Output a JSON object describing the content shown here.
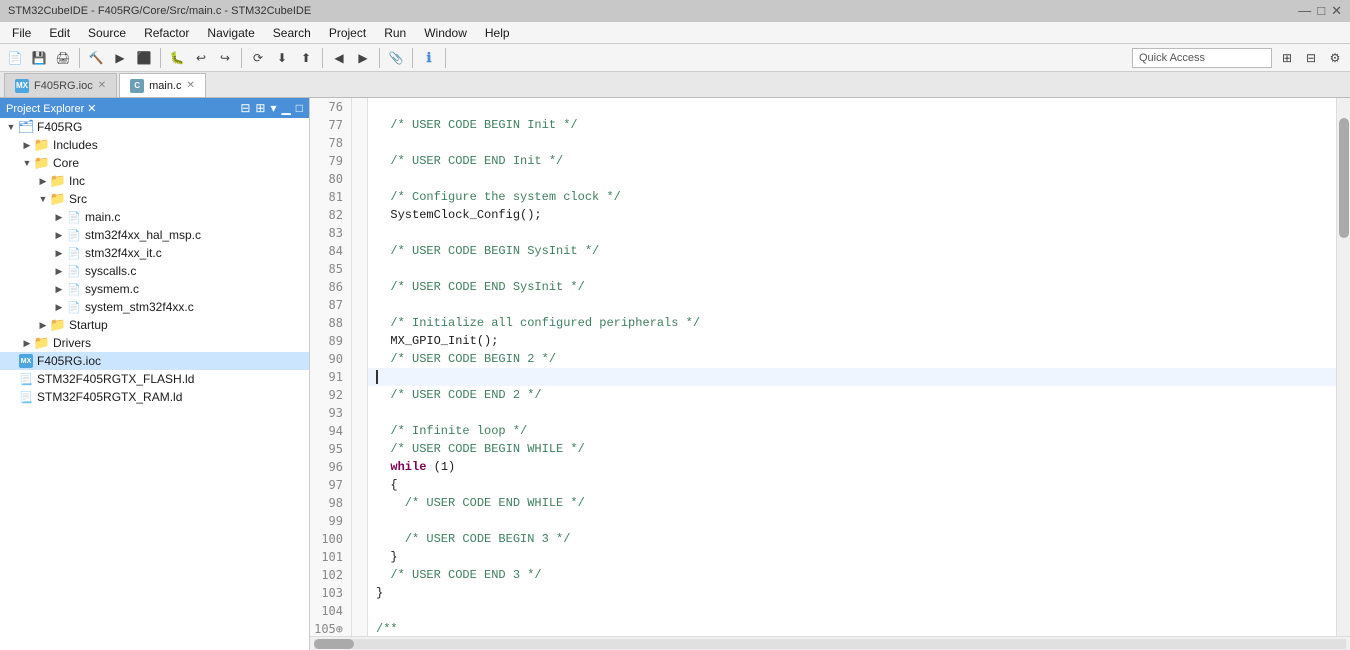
{
  "titlebar": {
    "title": "STM32CubeIDE - F405RG/Core/Src/main.c - STM32CubeIDE",
    "controls": [
      "—",
      "□",
      "✕"
    ]
  },
  "menubar": {
    "items": [
      "File",
      "Edit",
      "Source",
      "Refactor",
      "Navigate",
      "Search",
      "Project",
      "Run",
      "Window",
      "Help"
    ]
  },
  "toolbar": {
    "quick_access": "Quick Access"
  },
  "tabs": [
    {
      "label": "F405RG.ioc",
      "type": "ioc",
      "active": false
    },
    {
      "label": "main.c",
      "type": "c",
      "active": true
    }
  ],
  "sidebar": {
    "title": "Project Explorer",
    "tree": [
      {
        "level": 0,
        "arrow": "▼",
        "icon": "project",
        "label": "F405RG",
        "type": "project"
      },
      {
        "level": 1,
        "arrow": "▶",
        "icon": "folder",
        "label": "Includes",
        "type": "folder"
      },
      {
        "level": 1,
        "arrow": "▼",
        "icon": "folder",
        "label": "Core",
        "type": "folder"
      },
      {
        "level": 2,
        "arrow": "▶",
        "icon": "folder",
        "label": "Inc",
        "type": "folder"
      },
      {
        "level": 2,
        "arrow": "▼",
        "icon": "folder",
        "label": "Src",
        "type": "folder"
      },
      {
        "level": 3,
        "arrow": "▶",
        "icon": "file-c",
        "label": "main.c",
        "type": "file"
      },
      {
        "level": 3,
        "arrow": "▶",
        "icon": "file-c",
        "label": "stm32f4xx_hal_msp.c",
        "type": "file"
      },
      {
        "level": 3,
        "arrow": "▶",
        "icon": "file-c",
        "label": "stm32f4xx_it.c",
        "type": "file"
      },
      {
        "level": 3,
        "arrow": "▶",
        "icon": "file-c",
        "label": "syscalls.c",
        "type": "file"
      },
      {
        "level": 3,
        "arrow": "▶",
        "icon": "file-c",
        "label": "sysmem.c",
        "type": "file"
      },
      {
        "level": 3,
        "arrow": "▶",
        "icon": "file-c",
        "label": "system_stm32f4xx.c",
        "type": "file"
      },
      {
        "level": 2,
        "arrow": "▶",
        "icon": "folder",
        "label": "Startup",
        "type": "folder"
      },
      {
        "level": 1,
        "arrow": "▶",
        "icon": "folder",
        "label": "Drivers",
        "type": "folder"
      },
      {
        "level": 0,
        "arrow": "",
        "icon": "ioc",
        "label": "F405RG.ioc",
        "type": "ioc",
        "selected": true
      },
      {
        "level": 0,
        "arrow": "",
        "icon": "ld",
        "label": "STM32F405RGTX_FLASH.ld",
        "type": "ld"
      },
      {
        "level": 0,
        "arrow": "",
        "icon": "ld",
        "label": "STM32F405RGTX_RAM.ld",
        "type": "ld"
      }
    ]
  },
  "code": {
    "lines": [
      {
        "num": 76,
        "text": "",
        "type": "normal"
      },
      {
        "num": 77,
        "text": "  /* USER CODE BEGIN Init */",
        "type": "comment"
      },
      {
        "num": 78,
        "text": "",
        "type": "normal"
      },
      {
        "num": 79,
        "text": "  /* USER CODE END Init */",
        "type": "comment"
      },
      {
        "num": 80,
        "text": "",
        "type": "normal"
      },
      {
        "num": 81,
        "text": "  /* Configure the system clock */",
        "type": "comment"
      },
      {
        "num": 82,
        "text": "  SystemClock_Config();",
        "type": "normal"
      },
      {
        "num": 83,
        "text": "",
        "type": "normal"
      },
      {
        "num": 84,
        "text": "  /* USER CODE BEGIN SysInit */",
        "type": "comment"
      },
      {
        "num": 85,
        "text": "",
        "type": "normal"
      },
      {
        "num": 86,
        "text": "  /* USER CODE END SysInit */",
        "type": "comment"
      },
      {
        "num": 87,
        "text": "",
        "type": "normal"
      },
      {
        "num": 88,
        "text": "  /* Initialize all configured peripherals */",
        "type": "comment"
      },
      {
        "num": 89,
        "text": "  MX_GPIO_Init();",
        "type": "normal"
      },
      {
        "num": 90,
        "text": "  /* USER CODE BEGIN 2 */",
        "type": "comment"
      },
      {
        "num": 91,
        "text": "",
        "type": "cursor",
        "highlighted": true
      },
      {
        "num": 92,
        "text": "  /* USER CODE END 2 */",
        "type": "comment"
      },
      {
        "num": 93,
        "text": "",
        "type": "normal"
      },
      {
        "num": 94,
        "text": "  /* Infinite loop */",
        "type": "comment"
      },
      {
        "num": 95,
        "text": "  /* USER CODE BEGIN WHILE */",
        "type": "comment"
      },
      {
        "num": 96,
        "text": "  while (1)",
        "type": "keyword-line"
      },
      {
        "num": 97,
        "text": "  {",
        "type": "normal"
      },
      {
        "num": 98,
        "text": "    /* USER CODE END WHILE */",
        "type": "comment"
      },
      {
        "num": 99,
        "text": "",
        "type": "normal"
      },
      {
        "num": 100,
        "text": "    /* USER CODE BEGIN 3 */",
        "type": "comment"
      },
      {
        "num": 101,
        "text": "  }",
        "type": "normal"
      },
      {
        "num": 102,
        "text": "  /* USER CODE END 3 */",
        "type": "comment"
      },
      {
        "num": 103,
        "text": "}",
        "type": "normal"
      },
      {
        "num": 104,
        "text": "",
        "type": "normal"
      },
      {
        "num": "105⊕",
        "text": "/**",
        "type": "comment"
      }
    ]
  }
}
